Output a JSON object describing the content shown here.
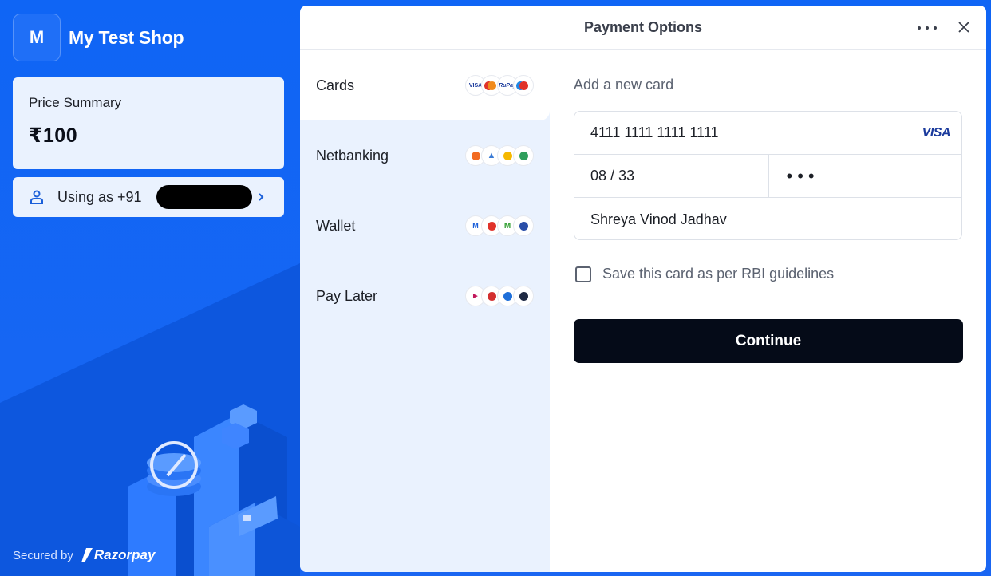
{
  "merchant": {
    "initial": "M",
    "name": "My Test Shop"
  },
  "price_summary": {
    "label": "Price Summary",
    "amount": "₹100"
  },
  "user": {
    "label": "Using as +91"
  },
  "footer": {
    "secured_label": "Secured by",
    "brand": "Razorpay"
  },
  "modal": {
    "title": "Payment Options",
    "methods": [
      {
        "label": "Cards",
        "icons": [
          "visa-icon",
          "mastercard-icon",
          "rupay-icon",
          "maestro-icon"
        ]
      },
      {
        "label": "Netbanking",
        "icons": [
          "bank-of-baroda-icon",
          "axis-bank-icon",
          "canara-bank-icon",
          "sbi-icon"
        ]
      },
      {
        "label": "Wallet",
        "icons": [
          "mobikwik-icon",
          "airtel-payments-icon",
          "mpesa-icon",
          "freecharge-icon"
        ]
      },
      {
        "label": "Pay Later",
        "icons": [
          "paylater-icon",
          "icici-paylater-icon",
          "kotak-paylater-icon",
          "lazypay-icon"
        ]
      }
    ],
    "form": {
      "heading": "Add a new card",
      "card_number": "4111 1111 1111 1111",
      "card_brand": "VISA",
      "expiry": "08 / 33",
      "cvv": "•••",
      "name": "Shreya Vinod Jadhav",
      "save_label": "Save this card as per RBI guidelines",
      "continue_label": "Continue"
    }
  },
  "colors": {
    "brand_blue": "#1462f0",
    "panel_light": "#eaf2fe",
    "button_dark": "#050b18"
  }
}
